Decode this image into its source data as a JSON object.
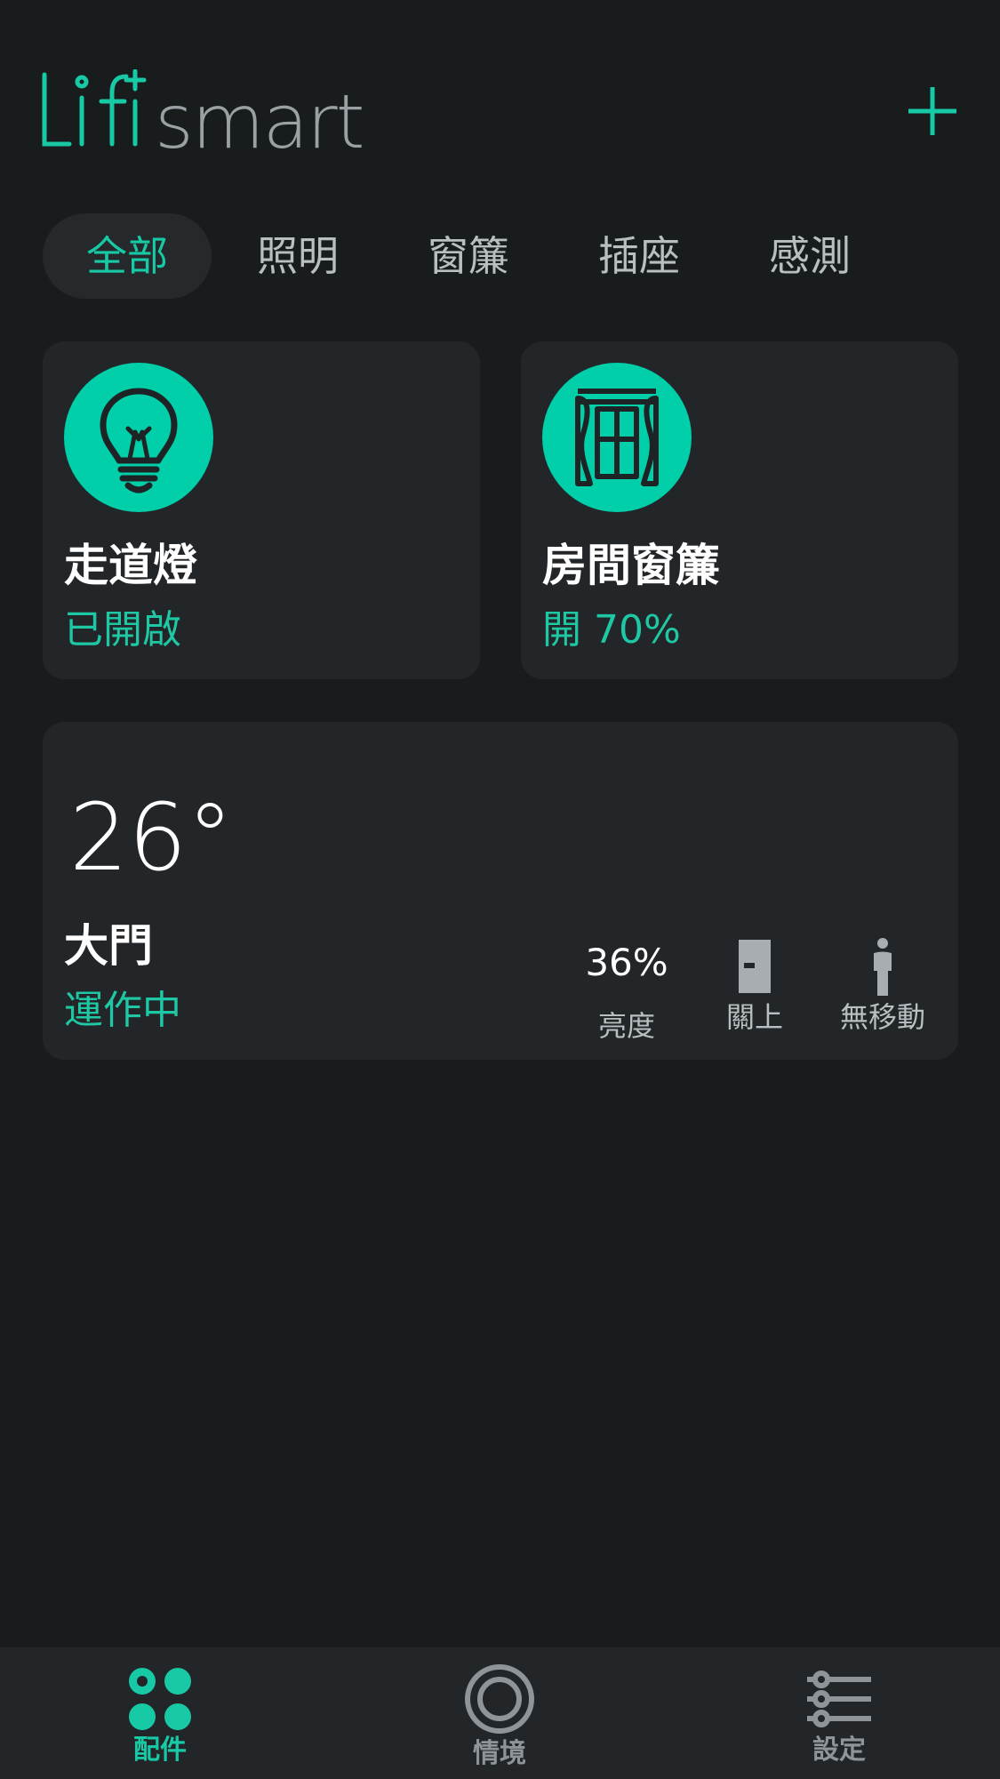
{
  "header": {
    "logo_mark": "Lifi",
    "logo_text": "smart",
    "add_icon": "plus-icon"
  },
  "tabs": [
    {
      "label": "全部",
      "active": true
    },
    {
      "label": "照明",
      "active": false
    },
    {
      "label": "窗簾",
      "active": false
    },
    {
      "label": "插座",
      "active": false
    },
    {
      "label": "感測",
      "active": false
    }
  ],
  "devices": [
    {
      "name": "走道燈",
      "status": "已開啟",
      "icon": "light-bulb-icon"
    },
    {
      "name": "房間窗簾",
      "status": "開 70%",
      "icon": "curtain-icon"
    }
  ],
  "sensor": {
    "temperature": "26°",
    "name": "大門",
    "status": "運作中",
    "brightness_value": "36%",
    "brightness_label": "亮度",
    "door_label": "關上",
    "door_icon": "door-closed-icon",
    "motion_label": "無移動",
    "motion_icon": "person-icon"
  },
  "nav": [
    {
      "label": "配件",
      "icon": "accessories-icon",
      "active": true
    },
    {
      "label": "情境",
      "icon": "scenes-icon",
      "active": false
    },
    {
      "label": "設定",
      "icon": "settings-sliders-icon",
      "active": false
    }
  ],
  "colors": {
    "accent": "#00cfaa",
    "background": "#191c1d",
    "card": "#232628",
    "muted": "#b9bec1"
  }
}
